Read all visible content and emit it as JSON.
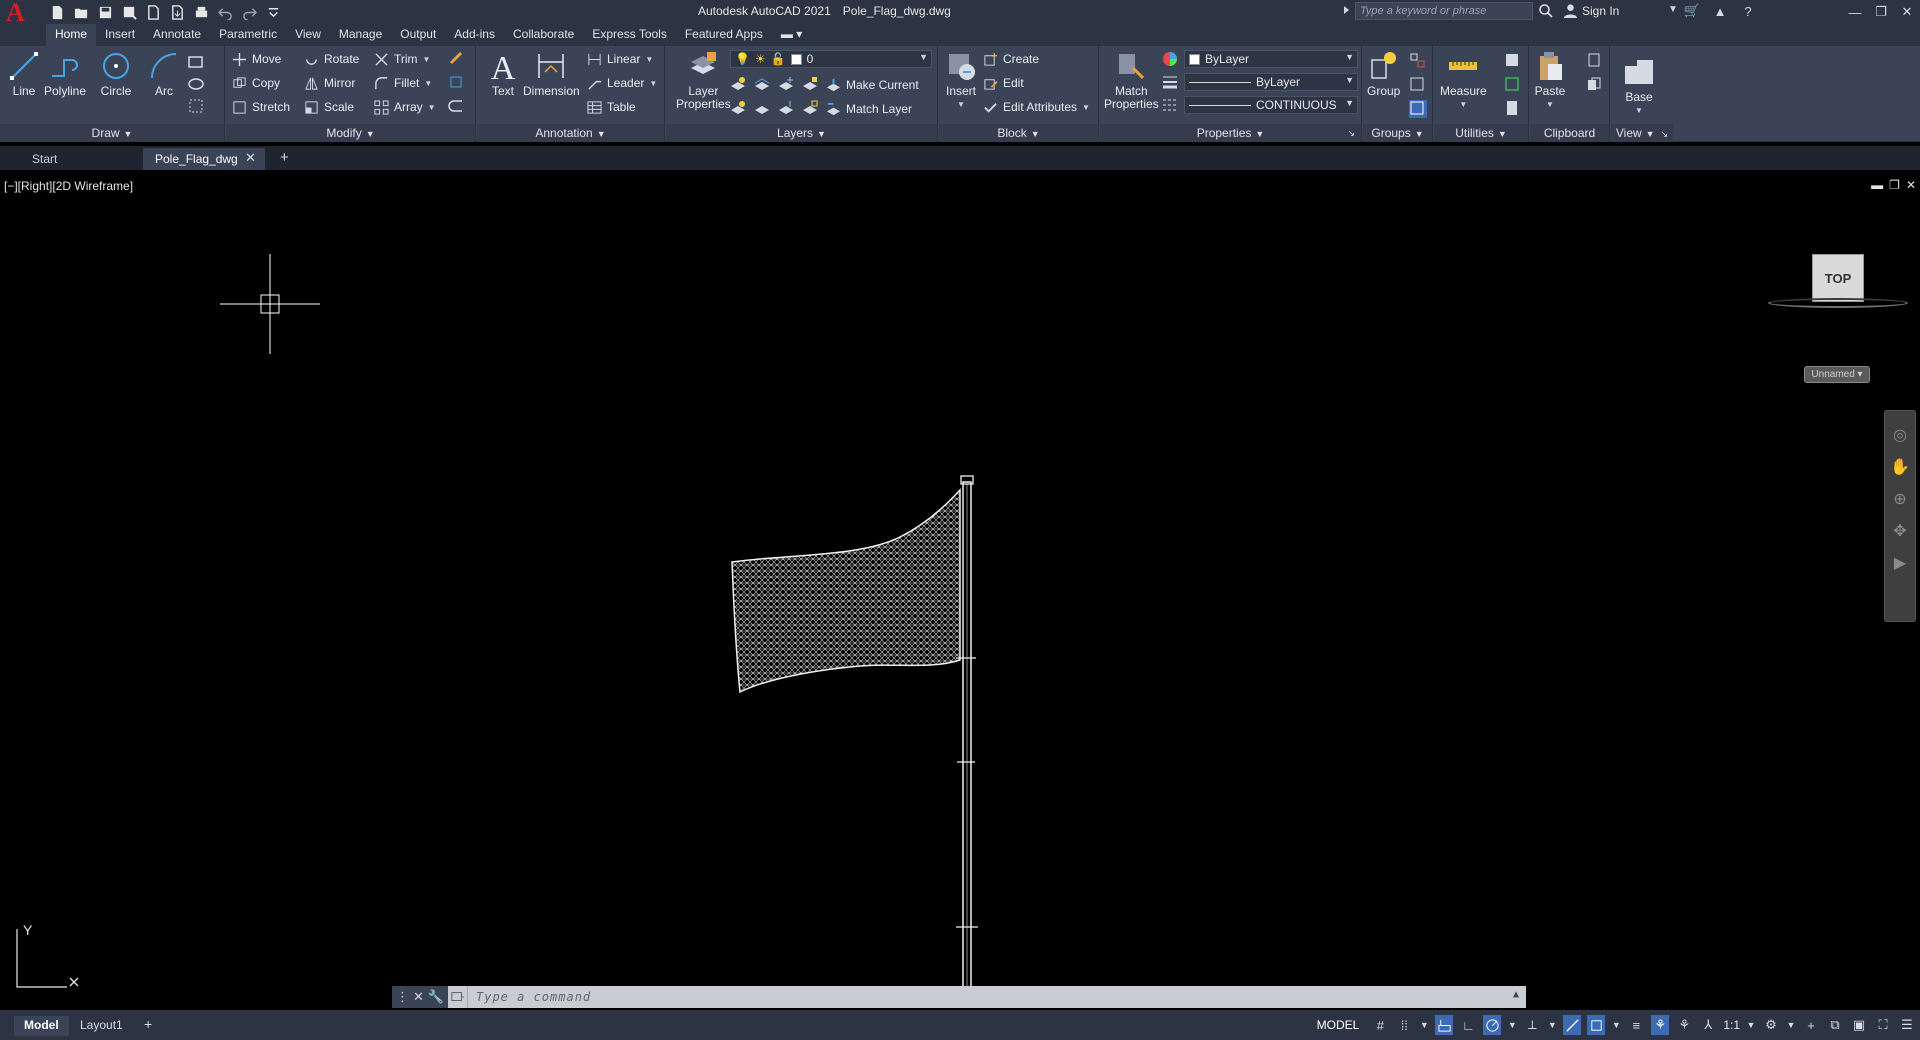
{
  "app": {
    "logo": "A",
    "title": "Autodesk AutoCAD 2021",
    "filename": "Pole_Flag_dwg.dwg",
    "search_placeholder": "Type a keyword or phrase",
    "signin_label": "Sign In"
  },
  "ribbon_tabs": [
    "Home",
    "Insert",
    "Annotate",
    "Parametric",
    "View",
    "Manage",
    "Output",
    "Add-ins",
    "Collaborate",
    "Express Tools",
    "Featured Apps"
  ],
  "draw": {
    "label": "Draw",
    "line": "Line",
    "polyline": "Polyline",
    "circle": "Circle",
    "arc": "Arc"
  },
  "modify": {
    "label": "Modify",
    "move": "Move",
    "rotate": "Rotate",
    "trim": "Trim",
    "copy": "Copy",
    "mirror": "Mirror",
    "fillet": "Fillet",
    "stretch": "Stretch",
    "scale": "Scale",
    "array": "Array"
  },
  "annotation": {
    "label": "Annotation",
    "text": "Text",
    "dimension": "Dimension",
    "linear": "Linear",
    "leader": "Leader",
    "table": "Table"
  },
  "layers": {
    "label": "Layers",
    "layer_properties_1": "Layer",
    "layer_properties_2": "Properties",
    "current_layer": "0",
    "make_current": "Make Current",
    "match_layer": "Match Layer"
  },
  "block": {
    "label": "Block",
    "insert": "Insert",
    "create": "Create",
    "edit": "Edit",
    "edit_attributes": "Edit Attributes"
  },
  "properties": {
    "label": "Properties",
    "match_1": "Match",
    "match_2": "Properties",
    "color": "ByLayer",
    "lineweight": "ByLayer",
    "linetype": "CONTINUOUS"
  },
  "groups": {
    "label": "Groups",
    "group": "Group"
  },
  "utilities": {
    "label": "Utilities",
    "measure": "Measure"
  },
  "clipboard": {
    "label": "Clipboard",
    "paste": "Paste"
  },
  "view_panel": {
    "label": "View",
    "base": "Base"
  },
  "doc_tabs": {
    "start": "Start",
    "active": "Pole_Flag_dwg"
  },
  "viewport": {
    "label": "[−][Right][2D Wireframe]",
    "viewcube_face": "TOP",
    "wcs_label": "Unnamed",
    "ucs_y": "Y"
  },
  "command": {
    "placeholder": "Type a command"
  },
  "status": {
    "model_tab": "Model",
    "layout_tab": "Layout1",
    "space": "MODEL",
    "scale": "1:1"
  },
  "colors": {
    "ribbon_bg": "#3b4457",
    "title_bg": "#2c3342",
    "accent": "#3c6bb4",
    "logo": "#d11f27"
  }
}
